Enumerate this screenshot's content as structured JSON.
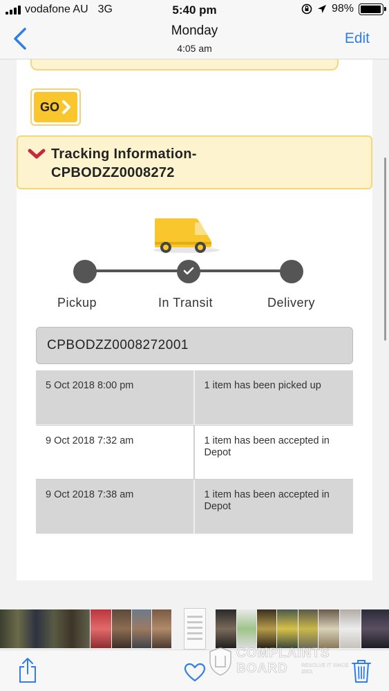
{
  "status_bar": {
    "carrier": "vodafone AU",
    "network": "3G",
    "time": "5:40 pm",
    "battery": "98%",
    "battery_level": 0.98
  },
  "nav": {
    "title": "Monday",
    "subtitle": "4:05 am",
    "edit_label": "Edit",
    "back_icon": "chevron-left-icon"
  },
  "tracking": {
    "go_label": "GO",
    "title_line1": "Tracking Information-",
    "title_line2": "CPBODZZ0008272",
    "steps": [
      {
        "label": "Pickup",
        "done": false
      },
      {
        "label": "In Transit",
        "done": true
      },
      {
        "label": "Delivery",
        "done": false
      }
    ],
    "consignment": "CPBODZZ0008272001",
    "events": [
      {
        "datetime": "5 Oct 2018 8:00 pm",
        "description": "1 item has been picked up"
      },
      {
        "datetime": "9 Oct 2018 7:32 am",
        "description": "1 item has been accepted in Depot"
      },
      {
        "datetime": "9 Oct 2018 7:38 am",
        "description": "1 item has been accepted in Depot"
      }
    ]
  },
  "watermark": {
    "line1": "COMPLAINTS",
    "line2": "BOARD",
    "tagline": "RESOLVE IT SINCE 2001"
  },
  "toolbar": {
    "share_icon": "share-icon",
    "favorite_icon": "heart-icon",
    "delete_icon": "trash-icon"
  },
  "colors": {
    "accent_blue": "#2f7ee8",
    "tracking_yellow": "#f9c72d",
    "box_fill": "#fdf4cf",
    "box_border": "#f2d87a",
    "chevron_red": "#c8283c",
    "progress_grey": "#555555"
  }
}
